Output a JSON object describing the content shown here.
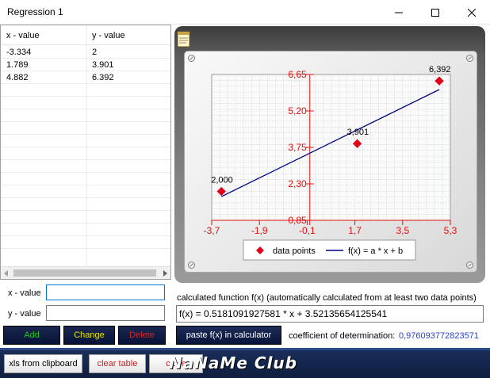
{
  "window": {
    "title": "Regression 1"
  },
  "table": {
    "headers": [
      "x - value",
      "y - value"
    ],
    "rows": [
      [
        "-3.334",
        "2"
      ],
      [
        "1.789",
        "3.901"
      ],
      [
        "4.882",
        "6.392"
      ]
    ]
  },
  "inputs": {
    "x_label": "x - value",
    "y_label": "y - value",
    "x_value": "",
    "y_value": ""
  },
  "actions": {
    "add": "Add",
    "change": "Change",
    "delete": "Delete"
  },
  "chart_data": {
    "type": "scatter",
    "x_ticks": [
      "-3,7",
      "-1,9",
      "-0,1",
      "1,7",
      "3,5",
      "5,3"
    ],
    "y_ticks": [
      "6,65",
      "5,20",
      "3,75",
      "2,30",
      "0,85"
    ],
    "xlim": [
      -3.7,
      5.3
    ],
    "ylim": [
      0.85,
      6.65
    ],
    "points": [
      {
        "x": -3.334,
        "y": 2.0,
        "label": "2,000"
      },
      {
        "x": 1.789,
        "y": 3.901,
        "label": "3,901"
      },
      {
        "x": 4.882,
        "y": 6.392,
        "label": "6,392"
      }
    ],
    "fit_line": {
      "slope": 0.5181091927581,
      "intercept": 3.52135654125541,
      "x_start": -3.334,
      "x_end": 4.882
    },
    "legend": {
      "points_label": "data points",
      "line_label": "f(x) = a * x + b",
      "placement": "bottom"
    },
    "grid": true,
    "point_color": "#e0001a",
    "line_color": "#000080",
    "axis_color": "#e01010",
    "grid_color": "#9ed6d6"
  },
  "result": {
    "calc_label": "calculated function  f(x) (automatically calculated from at least two data points)",
    "function_text": "f(x) = 0.5181091927581 * x + 3.52135654125541",
    "paste_button": "paste f(x) in calculator",
    "coef_label": "coefficient of determination:",
    "coef_value": "0,976093772823571"
  },
  "footer": {
    "xls_button": "xls from clipboard",
    "clear_button": "clear table",
    "close_button": "close",
    "watermark": "NaNaMe Club"
  }
}
